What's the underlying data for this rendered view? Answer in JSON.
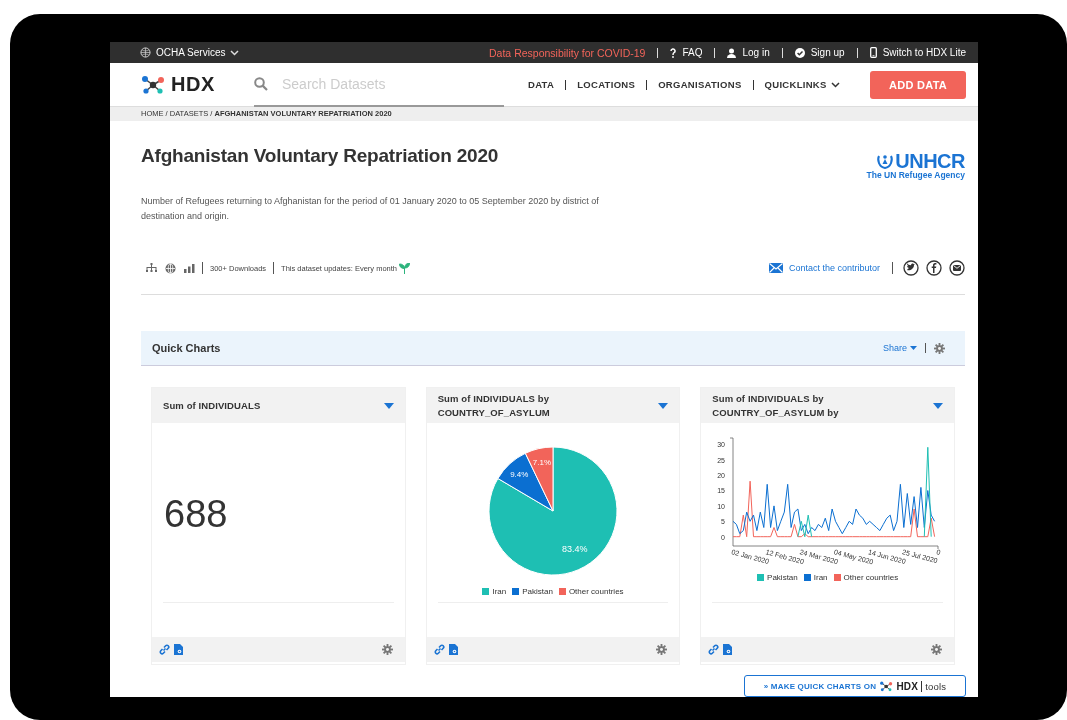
{
  "top_bar": {
    "org_menu": "OCHA Services",
    "alert_link": "Data Responsibility for COVID-19",
    "links": [
      {
        "kind": "faq",
        "label": "FAQ"
      },
      {
        "kind": "login",
        "label": "Log in"
      },
      {
        "kind": "signup",
        "label": "Sign up"
      },
      {
        "kind": "lite",
        "label": "Switch to HDX Lite"
      }
    ]
  },
  "nav": {
    "logo": "HDX",
    "search": {
      "placeholder": "Search Datasets"
    },
    "items": [
      {
        "label": "DATA",
        "dropdown": false
      },
      {
        "label": "LOCATIONS",
        "dropdown": false
      },
      {
        "label": "ORGANISATIONS",
        "dropdown": false
      },
      {
        "label": "QUICKLINKS",
        "dropdown": true
      }
    ],
    "add_button": "ADD DATA"
  },
  "breadcrumb": "HOME / DATASETS / **AFGHANISTAN VOLUNTARY REPATRIATION 2020**",
  "dataset": {
    "title": "Afghanistan Voluntary Repatriation 2020",
    "description": "Number of Refugees returning to Afghanistan for the period of 01 January 2020 to 05 September 2020 by district of destination and origin.",
    "publisher_logo": {
      "name": "UNHCR",
      "tagline": "The UN Refugee Agency"
    },
    "downloads": "300+ Downloads",
    "update_frequency": "This dataset updates: Every month",
    "contact": "Contact the contributor"
  },
  "quick_charts": {
    "title": "Quick Charts",
    "share": "Share",
    "charts": [
      {
        "kind": "number",
        "title": "Sum of INDIVIDUALS",
        "value": "688"
      },
      {
        "kind": "chart",
        "title": "Sum of INDIVIDUALS by COUNTRY_OF_ASYLUM",
        "chart_data": {
          "type": "pie",
          "categories": [
            "Iran",
            "Pakistan",
            "Other countries"
          ],
          "values": [
            83.4,
            9.4,
            7.1
          ],
          "value_labels": [
            "83.4%",
            "9.4%",
            "7.1%"
          ]
        }
      },
      {
        "kind": "chart",
        "title": "Sum of INDIVIDUALS by COUNTRY_OF_ASYLUM by",
        "chart_data": {
          "type": "line",
          "categories": [
            "02 Jan 2020",
            null,
            null,
            null,
            null,
            null,
            null,
            null,
            null,
            null,
            "12 Feb 2020",
            null,
            null,
            null,
            null,
            null,
            null,
            null,
            null,
            null,
            "24 Mar 2020",
            null,
            null,
            null,
            null,
            null,
            null,
            null,
            null,
            null,
            "04 May 2020",
            null,
            null,
            null,
            null,
            null,
            null,
            null,
            null,
            null,
            "14 Jun 2020",
            null,
            null,
            null,
            null,
            null,
            null,
            null,
            null,
            null,
            "25 Jul 2020",
            null,
            null,
            null,
            null,
            null,
            null,
            null,
            null,
            null,
            "0"
          ],
          "ylim": [
            -3,
            32
          ],
          "yticks": [
            0,
            5,
            10,
            15,
            20,
            25,
            30
          ],
          "series": [
            {
              "name": "Pakistan",
              "color": "#1ebfb3",
              "values": [
                null,
                null,
                null,
                null,
                null,
                null,
                null,
                null,
                null,
                null,
                null,
                null,
                null,
                null,
                null,
                null,
                null,
                null,
                null,
                0,
                5,
                0,
                7,
                0,
                null,
                null,
                null,
                null,
                null,
                null,
                null,
                null,
                null,
                null,
                null,
                null,
                null,
                null,
                null,
                null,
                null,
                null,
                null,
                null,
                null,
                null,
                null,
                null,
                null,
                null,
                null,
                null,
                null,
                null,
                null,
                null,
                0,
                29,
                0,
                null,
                null
              ]
            },
            {
              "name": "Iran",
              "color": "#0b6fd1",
              "values": [
                5,
                4,
                1,
                2,
                8,
                5,
                7,
                2,
                8,
                3,
                17,
                3,
                10,
                2,
                5,
                8,
                17,
                3,
                8,
                9,
                2,
                4,
                1,
                3,
                2,
                4,
                3,
                6,
                2,
                9,
                5,
                3,
                1,
                3,
                5,
                4,
                9,
                7,
                6,
                4,
                5,
                4,
                3,
                2,
                4,
                6,
                7,
                2,
                5,
                17,
                3,
                14,
                4,
                13,
                3,
                16,
                3,
                15,
                7,
                5,
                null
              ]
            },
            {
              "name": "Other countries",
              "color": "#f2645a",
              "values": [
                0,
                0,
                0,
                7,
                0,
                18,
                0,
                0,
                0,
                0,
                0,
                0,
                3,
                0,
                0,
                0,
                0,
                0,
                4,
                0,
                0,
                1,
                0,
                0,
                0,
                0,
                0,
                0,
                0,
                0,
                0,
                0,
                0,
                0,
                0,
                0,
                0,
                0,
                0,
                0,
                0,
                0,
                0,
                0,
                0,
                0,
                0,
                0,
                0,
                0,
                0,
                0,
                0,
                9,
                0,
                0,
                0,
                0,
                6,
                0,
                null
              ]
            }
          ]
        }
      }
    ]
  },
  "cta": {
    "text": "» MAKE QUICK CHARTS ON",
    "logo": "HDX",
    "suffix": "tools"
  }
}
